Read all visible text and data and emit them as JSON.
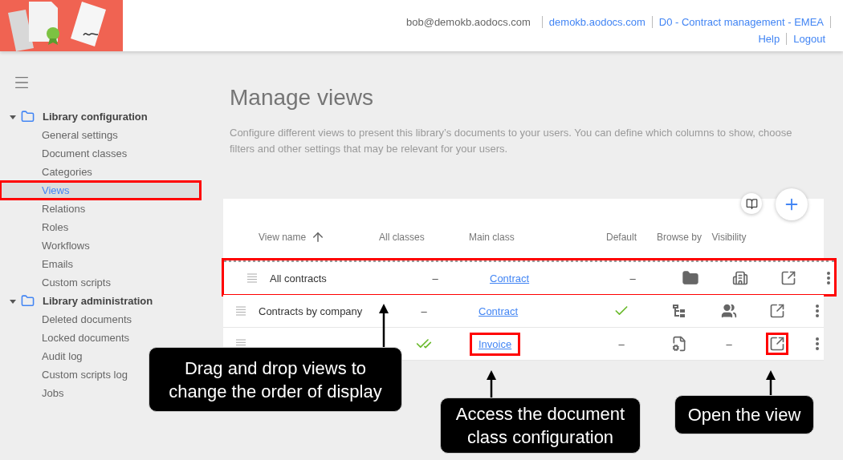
{
  "header": {
    "user": "bob@demokb.aodocs.com",
    "links": [
      "demokb.aodocs.com",
      "D0 - Contract management - EMEA"
    ],
    "links_2": [
      "Help",
      "Logout"
    ]
  },
  "sidebar": {
    "sections": [
      {
        "title": "Library configuration",
        "expanded": true,
        "items": [
          {
            "label": "General settings",
            "selected": false,
            "highlighted": false
          },
          {
            "label": "Document classes",
            "selected": false,
            "highlighted": false
          },
          {
            "label": "Categories",
            "selected": false,
            "highlighted": false
          },
          {
            "label": "Views",
            "selected": true,
            "highlighted": true
          },
          {
            "label": "Relations",
            "selected": false,
            "highlighted": false
          },
          {
            "label": "Roles",
            "selected": false,
            "highlighted": false
          },
          {
            "label": "Workflows",
            "selected": false,
            "highlighted": false
          },
          {
            "label": "Emails",
            "selected": false,
            "highlighted": false
          },
          {
            "label": "Custom scripts",
            "selected": false,
            "highlighted": false
          }
        ]
      },
      {
        "title": "Library administration",
        "expanded": true,
        "items": [
          {
            "label": "Deleted documents",
            "selected": false,
            "highlighted": false
          },
          {
            "label": "Locked documents",
            "selected": false,
            "highlighted": false
          },
          {
            "label": "Audit log",
            "selected": false,
            "highlighted": false
          },
          {
            "label": "Custom scripts log",
            "selected": false,
            "highlighted": false
          },
          {
            "label": "Jobs",
            "selected": false,
            "highlighted": false
          }
        ]
      }
    ]
  },
  "page": {
    "title": "Manage views",
    "description": "Configure different views to present this library’s documents to your users. You can define which columns to show, choose filters and other settings that may be relevant for your users."
  },
  "table": {
    "columns": [
      "View name",
      "All classes",
      "Main class",
      "Default",
      "Browse by",
      "Visibility"
    ],
    "rows": [
      {
        "name": "All contracts",
        "dragging": true,
        "highlighted": true,
        "all_classes": {
          "kind": "dash",
          "text": "–"
        },
        "main_class": "Contract",
        "main_class_highlighted": false,
        "default": {
          "kind": "dash",
          "text": "–"
        },
        "browse_by": {
          "kind": "folder"
        },
        "visibility": {
          "kind": "building"
        },
        "open_highlighted": false
      },
      {
        "name": "Contracts by company",
        "dragging": false,
        "highlighted": false,
        "all_classes": {
          "kind": "dash",
          "text": "–"
        },
        "main_class": "Contract",
        "main_class_highlighted": false,
        "default": {
          "kind": "check"
        },
        "browse_by": {
          "kind": "tree"
        },
        "visibility": {
          "kind": "people"
        },
        "open_highlighted": false
      },
      {
        "dragging": false,
        "highlighted": false,
        "all_classes": {
          "kind": "double-check"
        },
        "main_class": "Invoice",
        "main_class_highlighted": true,
        "default": {
          "kind": "dash",
          "text": "–"
        },
        "browse_by": {
          "kind": "doc-gear"
        },
        "visibility": {
          "kind": "dash",
          "text": "–"
        },
        "open_highlighted": true
      }
    ]
  },
  "callouts": [
    {
      "text": "Drag and drop views to change the order of display"
    },
    {
      "text": "Access the document class configuration"
    },
    {
      "text": "Open the view"
    }
  ]
}
